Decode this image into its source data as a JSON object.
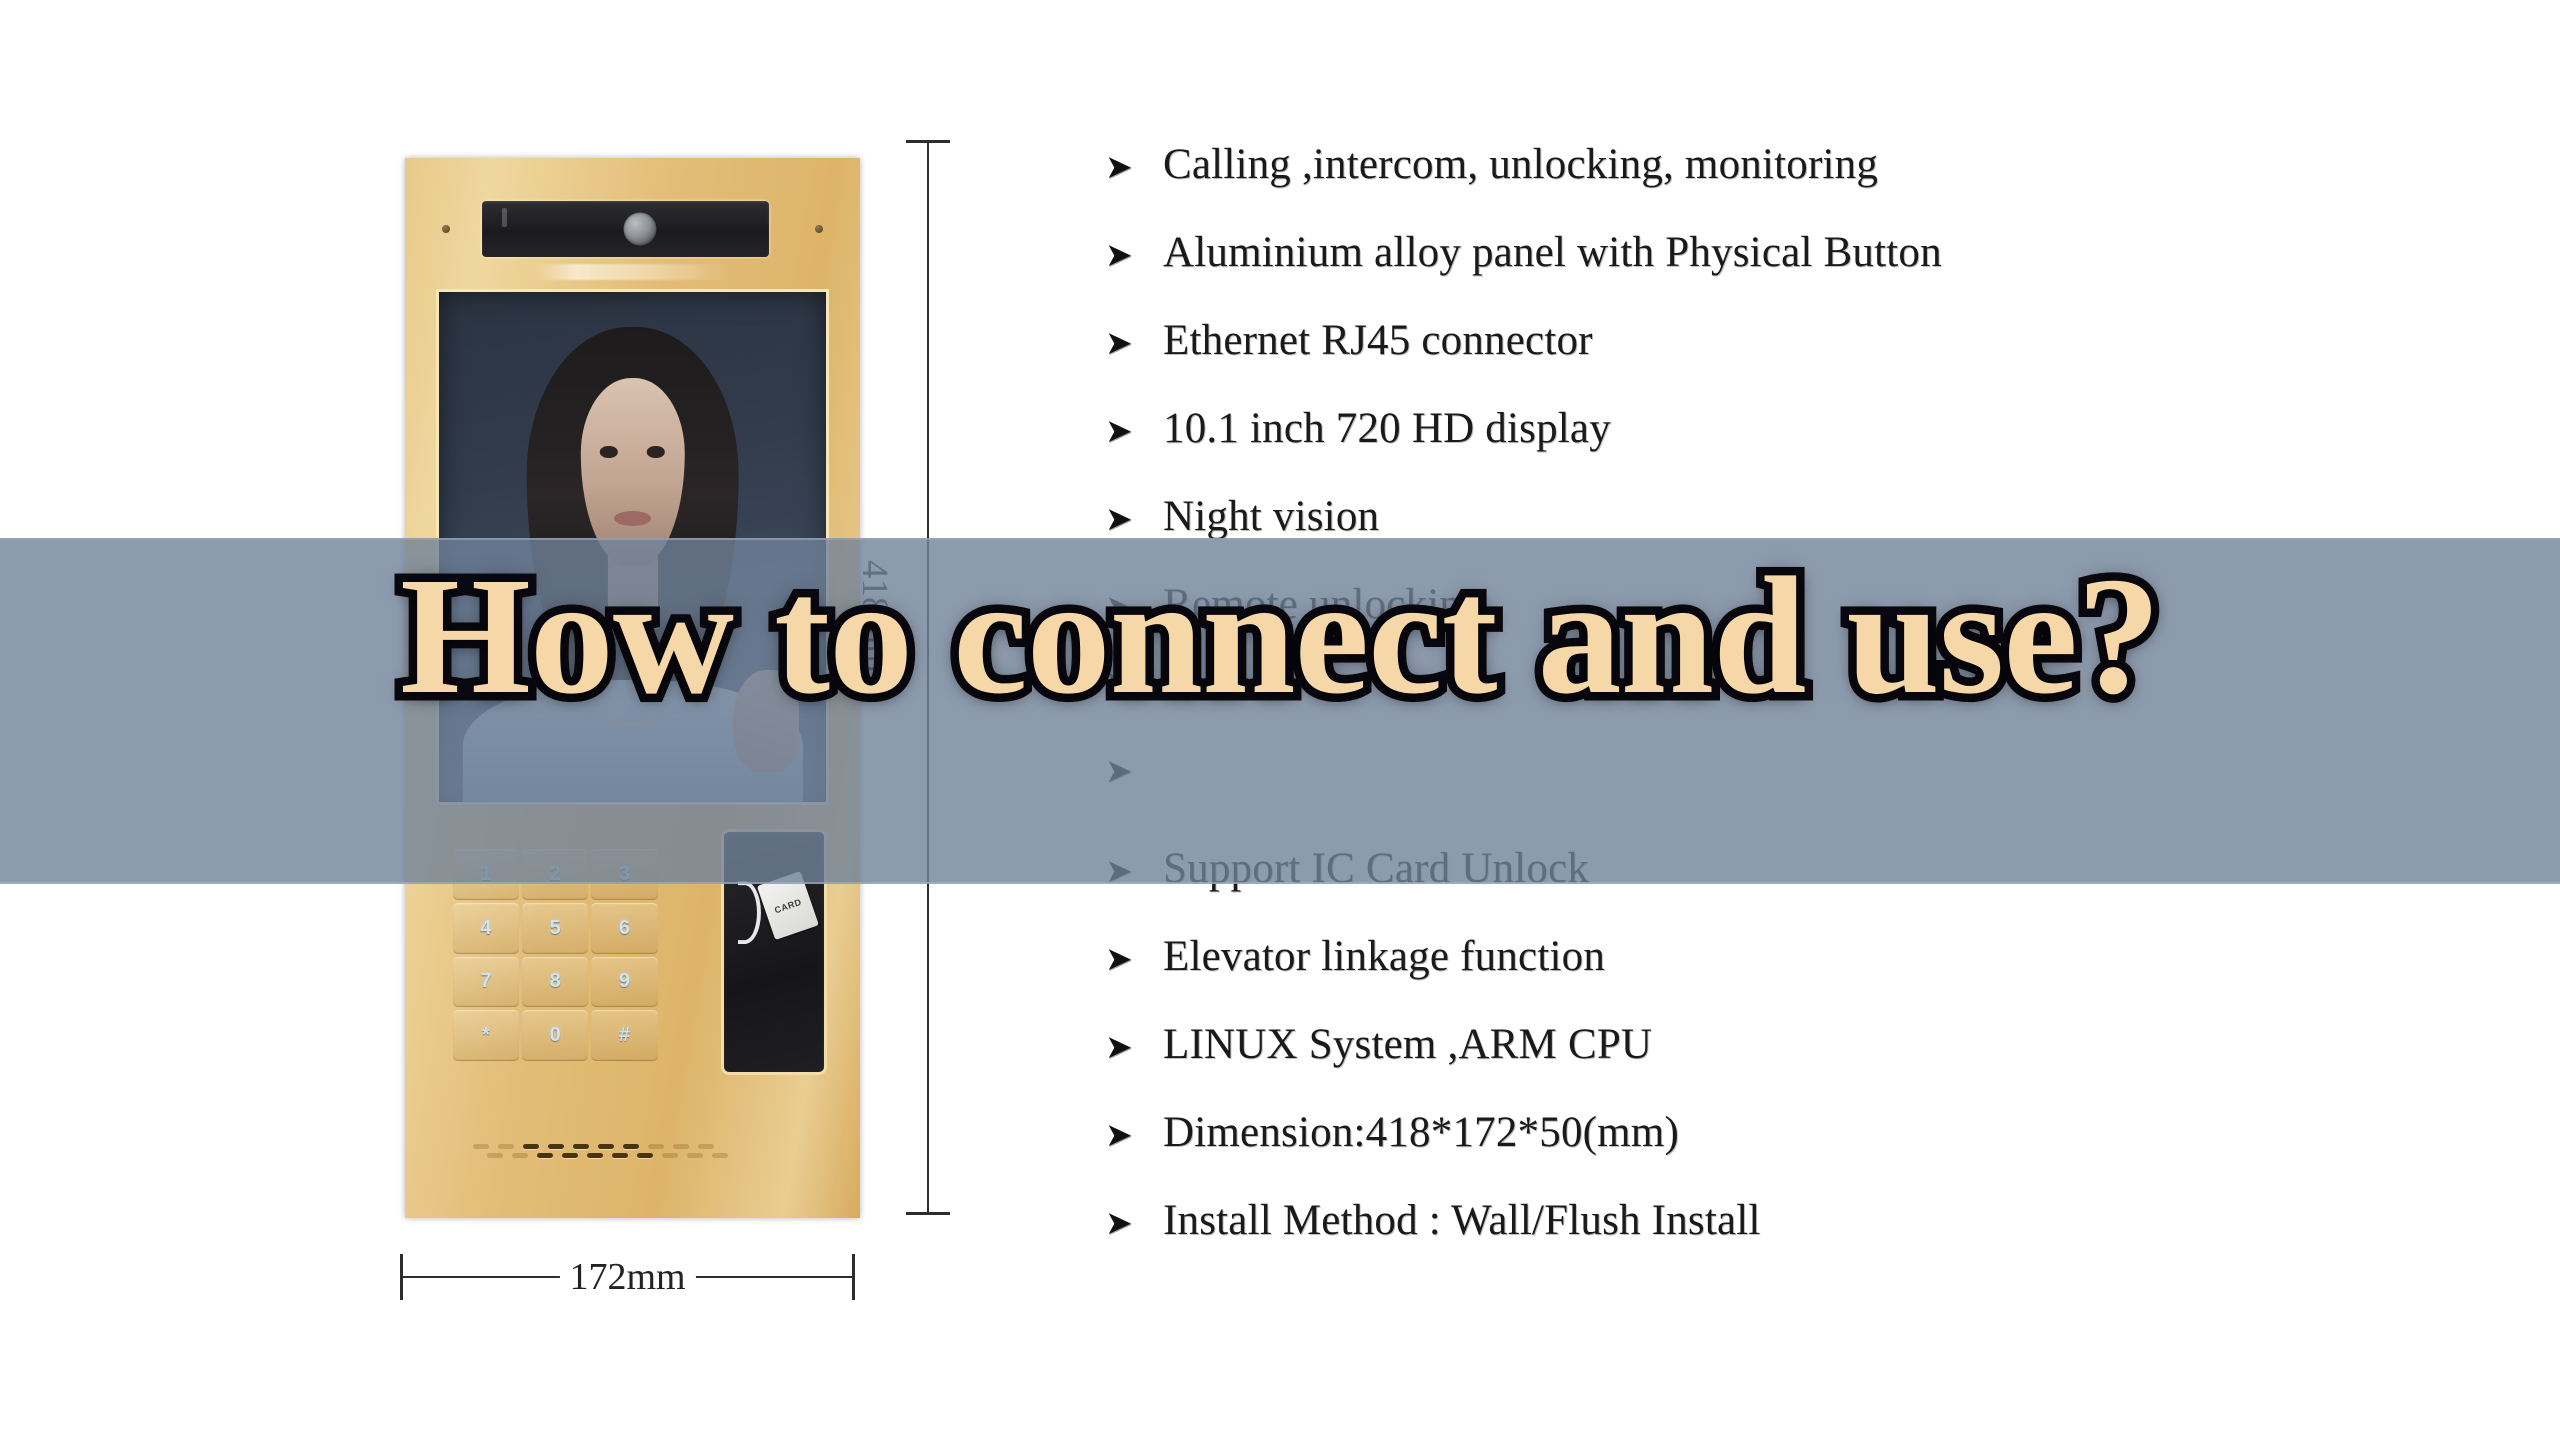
{
  "overlay": {
    "title": "How to connect and use?",
    "banner_color": "#70829a",
    "title_fill_color": "#f6d8a8",
    "title_outline_color": "#0b0a12"
  },
  "product": {
    "panel_color": "#e3bd78",
    "screen_color": "#3d4c60",
    "keypad": {
      "keys": [
        "1",
        "2",
        "3",
        "4",
        "5",
        "6",
        "7",
        "8",
        "9",
        "*",
        "0",
        "#"
      ]
    },
    "card_reader": {
      "label": "CARD",
      "color": "#1a191d"
    }
  },
  "dimensions": {
    "height_label": "418mm",
    "width_label": "172mm"
  },
  "features": {
    "bullet_glyph": "➤",
    "items": [
      {
        "text": "Calling ,intercom, unlocking, monitoring",
        "obscured": false
      },
      {
        "text": "Aluminium alloy panel with Physical Button",
        "obscured": false
      },
      {
        "text": "Ethernet RJ45 connector",
        "obscured": false
      },
      {
        "text": "10.1 inch 720 HD display",
        "obscured": false
      },
      {
        "text": "Night vision",
        "obscured": false
      },
      {
        "text": "Remote unlocking",
        "obscured": true
      },
      {
        "text": "",
        "obscured": true
      },
      {
        "text": "",
        "obscured": true
      },
      {
        "text": "Support IC Card Unlock",
        "obscured": true
      },
      {
        "text": "Elevator linkage function",
        "obscured": false
      },
      {
        "text": "LINUX System ,ARM CPU",
        "obscured": false
      },
      {
        "text": "Dimension:418*172*50(mm)",
        "obscured": false
      },
      {
        "text": "Install Method : Wall/Flush Install",
        "obscured": false
      }
    ]
  }
}
